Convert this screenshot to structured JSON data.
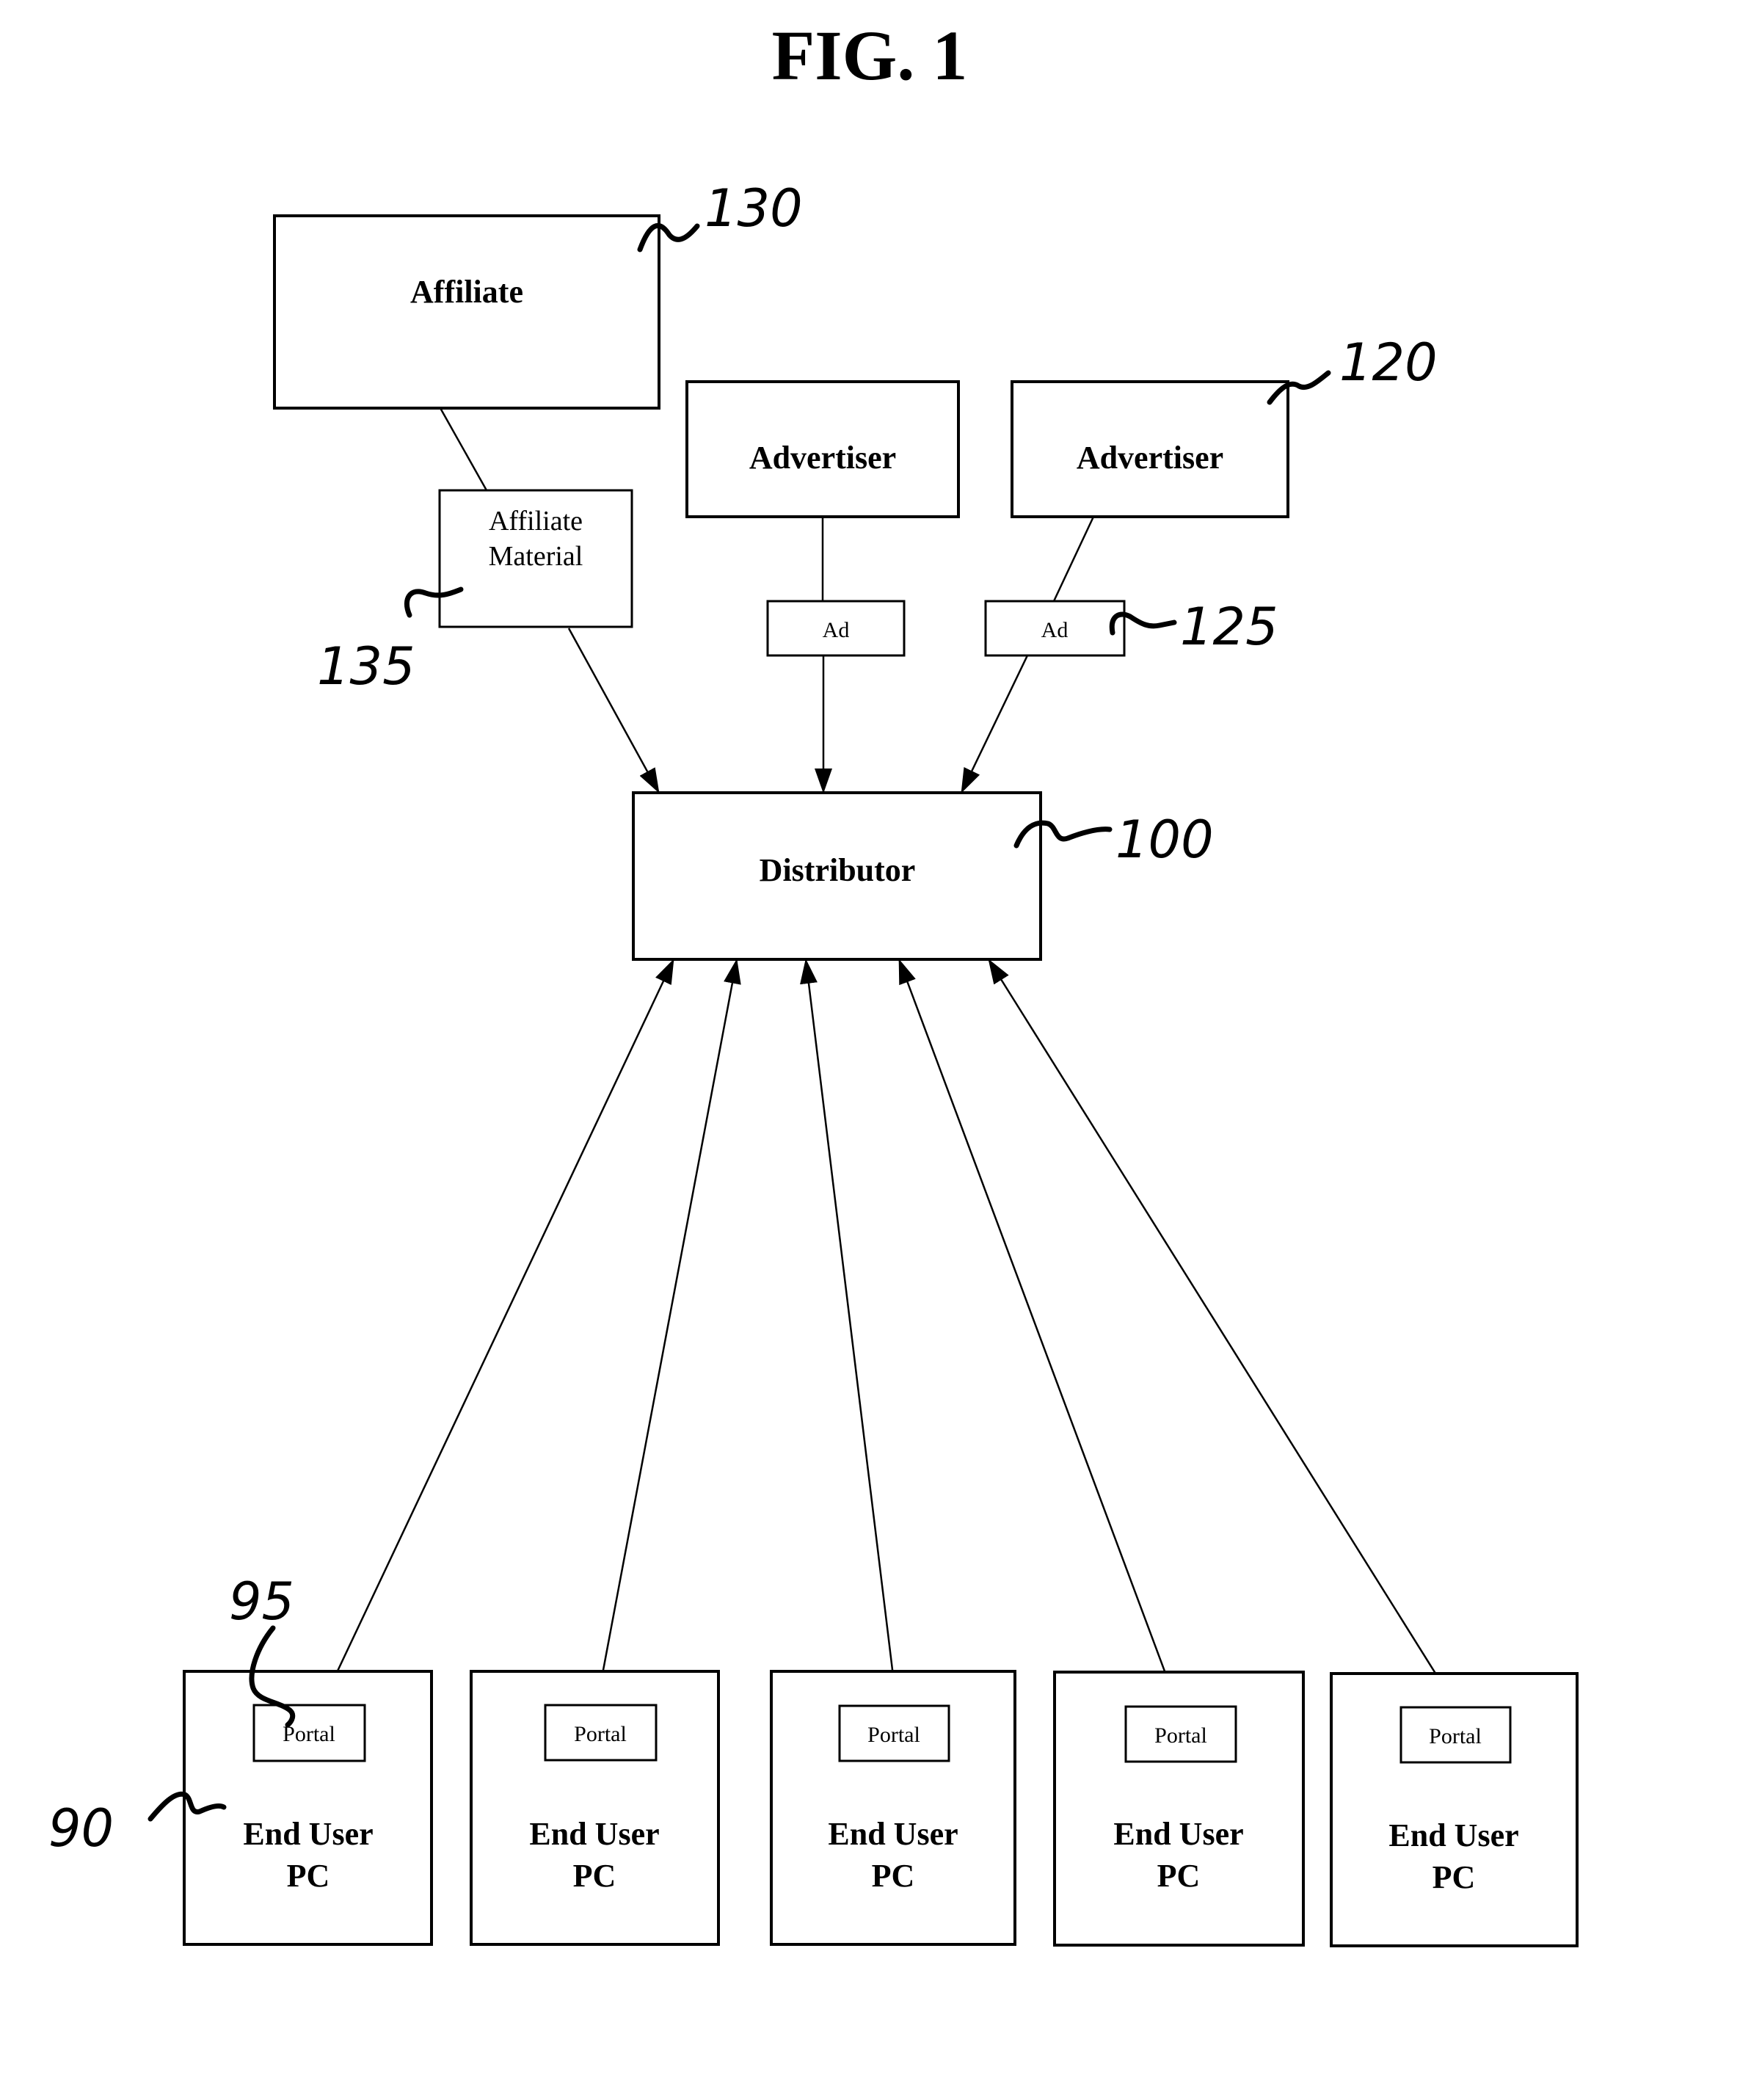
{
  "figure": {
    "title": "FIG. 1"
  },
  "nodes": {
    "affiliate": {
      "label": "Affiliate",
      "ref": "130"
    },
    "affiliate_material": {
      "label_line1": "Affiliate",
      "label_line2": "Material",
      "ref": "135"
    },
    "advertiser_1": {
      "label": "Advertiser"
    },
    "advertiser_2": {
      "label": "Advertiser",
      "ref": "120"
    },
    "ad_1": {
      "label": "Ad"
    },
    "ad_2": {
      "label": "Ad",
      "ref": "125"
    },
    "distributor": {
      "label": "Distributor",
      "ref": "100"
    },
    "end_users": [
      {
        "line1": "End User",
        "line2": "PC",
        "portal": "Portal"
      },
      {
        "line1": "End User",
        "line2": "PC",
        "portal": "Portal"
      },
      {
        "line1": "End User",
        "line2": "PC",
        "portal": "Portal"
      },
      {
        "line1": "End User",
        "line2": "PC",
        "portal": "Portal"
      },
      {
        "line1": "End User",
        "line2": "PC",
        "portal": "Portal"
      }
    ],
    "end_user_ref": "90",
    "portal_ref": "95"
  },
  "edges": [
    {
      "from": "Affiliate",
      "to": "Affiliate Material",
      "type": "line"
    },
    {
      "from": "Affiliate Material",
      "to": "Distributor",
      "type": "arrow"
    },
    {
      "from": "Advertiser",
      "to": "Ad",
      "type": "line"
    },
    {
      "from": "Ad",
      "to": "Distributor",
      "type": "arrow"
    },
    {
      "from": "Advertiser",
      "to": "Ad",
      "type": "line"
    },
    {
      "from": "Ad",
      "to": "Distributor",
      "type": "arrow"
    },
    {
      "from": "Distributor",
      "to": "Portal 1",
      "type": "bidirectional"
    },
    {
      "from": "Distributor",
      "to": "Portal 2",
      "type": "bidirectional"
    },
    {
      "from": "Distributor",
      "to": "Portal 3",
      "type": "bidirectional"
    },
    {
      "from": "Distributor",
      "to": "Portal 4",
      "type": "bidirectional"
    },
    {
      "from": "Distributor",
      "to": "Portal 5",
      "type": "bidirectional"
    }
  ]
}
